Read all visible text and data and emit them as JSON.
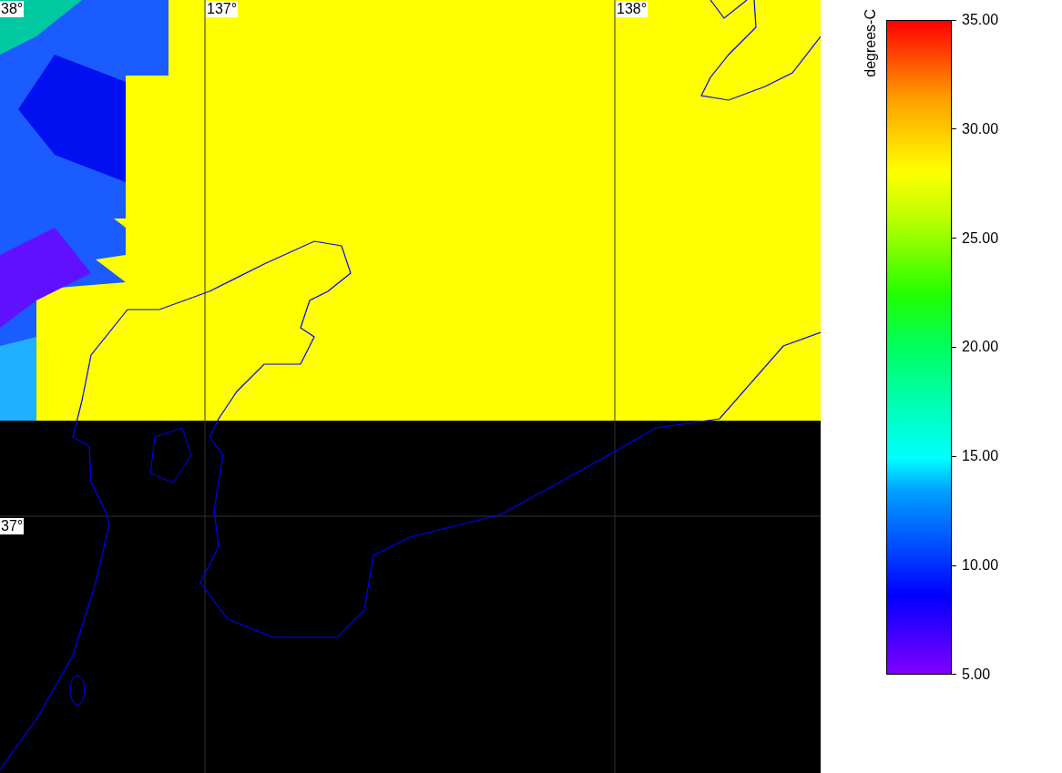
{
  "map": {
    "longitude_labels": [
      "137°",
      "138°"
    ],
    "latitude_labels": [
      "38°",
      "37°"
    ]
  },
  "colorbar": {
    "unit": "degrees-C",
    "ticks": [
      "35.00",
      "30.00",
      "25.00",
      "20.00",
      "15.00",
      "10.00",
      "5.00"
    ]
  }
}
